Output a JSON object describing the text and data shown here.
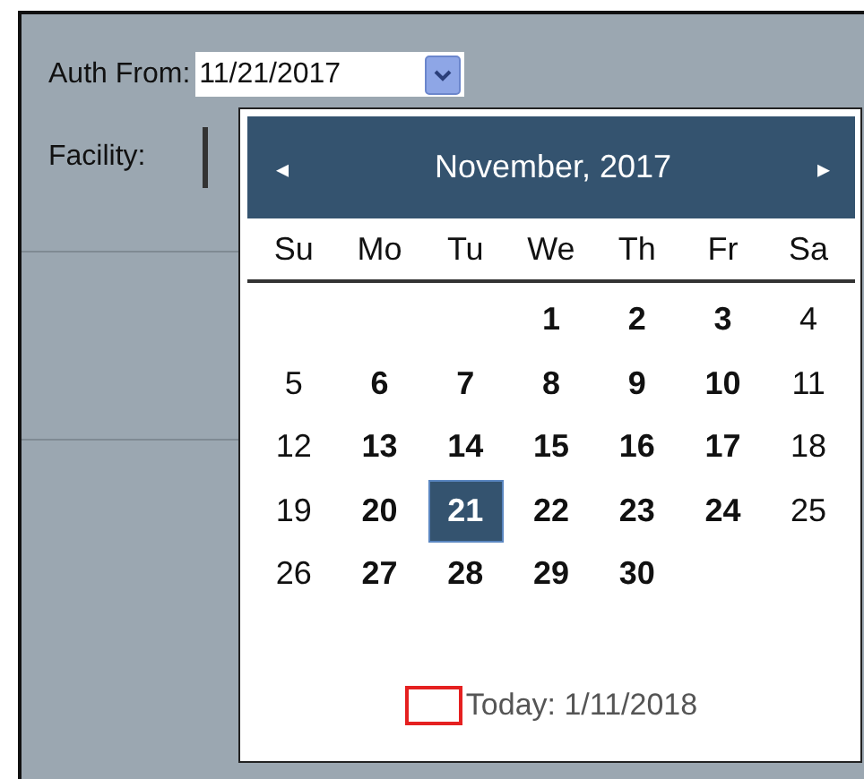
{
  "auth_from": {
    "label": "Auth From:",
    "value": "11/21/2017"
  },
  "facility": {
    "label": "Facility:"
  },
  "calendar": {
    "title": "November, 2017",
    "prev": "◂",
    "next": "▸",
    "weekdays": [
      "Su",
      "Mo",
      "Tu",
      "We",
      "Th",
      "Fr",
      "Sa"
    ],
    "weeks": [
      [
        {
          "kind": "blank"
        },
        {
          "kind": "blank"
        },
        {
          "kind": "blank"
        },
        {
          "day": "1",
          "kind": "weekday",
          "selected": false
        },
        {
          "day": "2",
          "kind": "weekday",
          "selected": false
        },
        {
          "day": "3",
          "kind": "weekday",
          "selected": false
        },
        {
          "day": "4",
          "kind": "weekend",
          "selected": false
        }
      ],
      [
        {
          "day": "5",
          "kind": "weekend",
          "selected": false
        },
        {
          "day": "6",
          "kind": "weekday",
          "selected": false
        },
        {
          "day": "7",
          "kind": "weekday",
          "selected": false
        },
        {
          "day": "8",
          "kind": "weekday",
          "selected": false
        },
        {
          "day": "9",
          "kind": "weekday",
          "selected": false
        },
        {
          "day": "10",
          "kind": "weekday",
          "selected": false
        },
        {
          "day": "11",
          "kind": "weekend",
          "selected": false
        }
      ],
      [
        {
          "day": "12",
          "kind": "weekend",
          "selected": false
        },
        {
          "day": "13",
          "kind": "weekday",
          "selected": false
        },
        {
          "day": "14",
          "kind": "weekday",
          "selected": false
        },
        {
          "day": "15",
          "kind": "weekday",
          "selected": false
        },
        {
          "day": "16",
          "kind": "weekday",
          "selected": false
        },
        {
          "day": "17",
          "kind": "weekday",
          "selected": false
        },
        {
          "day": "18",
          "kind": "weekend",
          "selected": false
        }
      ],
      [
        {
          "day": "19",
          "kind": "weekend",
          "selected": false
        },
        {
          "day": "20",
          "kind": "weekday",
          "selected": false
        },
        {
          "day": "21",
          "kind": "weekday",
          "selected": true
        },
        {
          "day": "22",
          "kind": "weekday",
          "selected": false
        },
        {
          "day": "23",
          "kind": "weekday",
          "selected": false
        },
        {
          "day": "24",
          "kind": "weekday",
          "selected": false
        },
        {
          "day": "25",
          "kind": "weekend",
          "selected": false
        }
      ],
      [
        {
          "day": "26",
          "kind": "weekend",
          "selected": false
        },
        {
          "day": "27",
          "kind": "weekday",
          "selected": false
        },
        {
          "day": "28",
          "kind": "weekday",
          "selected": false
        },
        {
          "day": "29",
          "kind": "weekday",
          "selected": false
        },
        {
          "day": "30",
          "kind": "weekday",
          "selected": false
        },
        {
          "kind": "blank"
        },
        {
          "kind": "blank"
        }
      ]
    ],
    "today": "Today: 1/11/2018"
  }
}
